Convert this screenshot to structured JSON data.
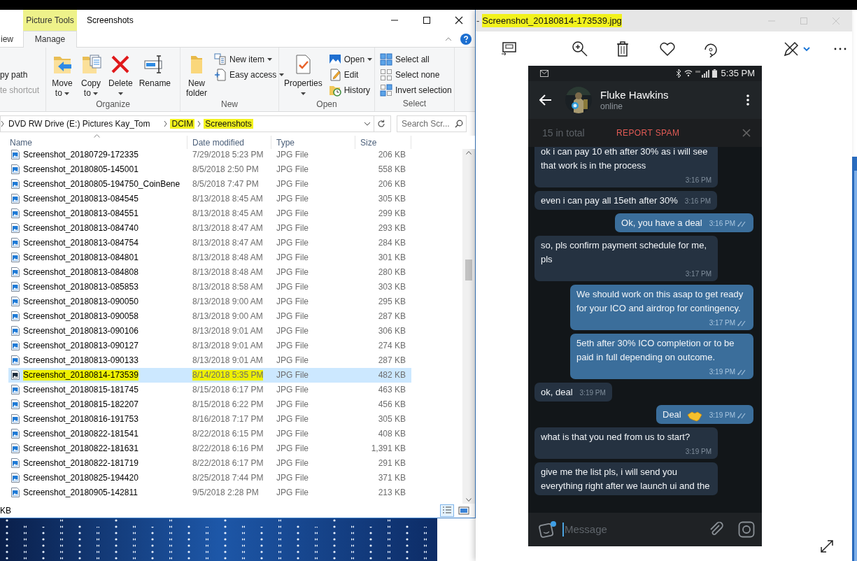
{
  "explorer": {
    "context_tab": {
      "label": "Picture Tools",
      "highlighted": true
    },
    "title": "Screenshots",
    "tabs": [
      {
        "label": "iew",
        "selected": false
      },
      {
        "label": "Manage",
        "selected": true
      }
    ],
    "ribbon": {
      "partial": [
        {
          "label": "py path",
          "disabled": false
        },
        {
          "label": "te shortcut",
          "disabled": true
        }
      ],
      "groups": [
        {
          "label": "Organize",
          "items": [
            {
              "kind": "move",
              "label": "Move to",
              "has_menu": true
            },
            {
              "kind": "copy",
              "label": "Copy to",
              "has_menu": true
            },
            {
              "kind": "delete",
              "label": "Delete",
              "has_menu": true
            },
            {
              "kind": "rename",
              "label": "Rename",
              "has_menu": false
            }
          ]
        },
        {
          "label": "New",
          "items": [
            {
              "kind": "new_folder",
              "label": "New folder",
              "has_menu": false
            },
            {
              "kind": "new_item",
              "label": "New item",
              "has_menu": true
            },
            {
              "kind": "easy_access",
              "label": "Easy access",
              "has_menu": true
            }
          ]
        },
        {
          "label": "Open",
          "items": [
            {
              "kind": "properties",
              "label": "Properties",
              "has_menu": true
            },
            {
              "kind": "open",
              "label": "Open",
              "has_menu": true
            },
            {
              "kind": "edit",
              "label": "Edit",
              "has_menu": false
            },
            {
              "kind": "history",
              "label": "History",
              "has_menu": false
            }
          ]
        },
        {
          "label": "Select",
          "items": [
            {
              "kind": "select_all",
              "label": "Select all",
              "has_menu": false
            },
            {
              "kind": "select_none",
              "label": "Select none",
              "has_menu": false
            },
            {
              "kind": "invert_selection",
              "label": "Invert selection",
              "has_menu": false
            }
          ]
        }
      ]
    },
    "path": [
      {
        "label": "DVD RW Drive (E:) Pictures Kay_Tom",
        "highlighted": false
      },
      {
        "label": "DCIM",
        "highlighted": true
      },
      {
        "label": "Screenshots",
        "highlighted": true
      }
    ],
    "search": {
      "placeholder": "Search Scr..."
    },
    "columns": [
      {
        "label": "Name",
        "sorted": true
      },
      {
        "label": "Date modified",
        "sorted": false
      },
      {
        "label": "Type",
        "sorted": false
      },
      {
        "label": "Size",
        "sorted": false
      }
    ],
    "rows": [
      {
        "name": "Screenshot_20180729-172335",
        "date": "7/29/2018 5:23 PM",
        "type": "JPG File",
        "size": "206 KB",
        "selected": false,
        "highlighted": false
      },
      {
        "name": "Screenshot_20180805-145001",
        "date": "8/5/2018 2:50 PM",
        "type": "JPG File",
        "size": "558 KB",
        "selected": false,
        "highlighted": false
      },
      {
        "name": "Screenshot_20180805-194750_CoinBene",
        "date": "8/5/2018 7:47 PM",
        "type": "JPG File",
        "size": "206 KB",
        "selected": false,
        "highlighted": false
      },
      {
        "name": "Screenshot_20180813-084545",
        "date": "8/13/2018 8:45 AM",
        "type": "JPG File",
        "size": "305 KB",
        "selected": false,
        "highlighted": false
      },
      {
        "name": "Screenshot_20180813-084551",
        "date": "8/13/2018 8:45 AM",
        "type": "JPG File",
        "size": "299 KB",
        "selected": false,
        "highlighted": false
      },
      {
        "name": "Screenshot_20180813-084740",
        "date": "8/13/2018 8:47 AM",
        "type": "JPG File",
        "size": "293 KB",
        "selected": false,
        "highlighted": false
      },
      {
        "name": "Screenshot_20180813-084754",
        "date": "8/13/2018 8:47 AM",
        "type": "JPG File",
        "size": "284 KB",
        "selected": false,
        "highlighted": false
      },
      {
        "name": "Screenshot_20180813-084801",
        "date": "8/13/2018 8:48 AM",
        "type": "JPG File",
        "size": "301 KB",
        "selected": false,
        "highlighted": false
      },
      {
        "name": "Screenshot_20180813-084808",
        "date": "8/13/2018 8:48 AM",
        "type": "JPG File",
        "size": "280 KB",
        "selected": false,
        "highlighted": false
      },
      {
        "name": "Screenshot_20180813-085853",
        "date": "8/13/2018 8:58 AM",
        "type": "JPG File",
        "size": "303 KB",
        "selected": false,
        "highlighted": false
      },
      {
        "name": "Screenshot_20180813-090050",
        "date": "8/13/2018 9:00 AM",
        "type": "JPG File",
        "size": "295 KB",
        "selected": false,
        "highlighted": false
      },
      {
        "name": "Screenshot_20180813-090058",
        "date": "8/13/2018 9:00 AM",
        "type": "JPG File",
        "size": "287 KB",
        "selected": false,
        "highlighted": false
      },
      {
        "name": "Screenshot_20180813-090106",
        "date": "8/13/2018 9:01 AM",
        "type": "JPG File",
        "size": "306 KB",
        "selected": false,
        "highlighted": false
      },
      {
        "name": "Screenshot_20180813-090127",
        "date": "8/13/2018 9:01 AM",
        "type": "JPG File",
        "size": "274 KB",
        "selected": false,
        "highlighted": false
      },
      {
        "name": "Screenshot_20180813-090133",
        "date": "8/13/2018 9:01 AM",
        "type": "JPG File",
        "size": "287 KB",
        "selected": false,
        "highlighted": false
      },
      {
        "name": "Screenshot_20180814-173539",
        "date": "8/14/2018 5:35 PM",
        "type": "JPG File",
        "size": "482 KB",
        "selected": true,
        "highlighted": true
      },
      {
        "name": "Screenshot_20180815-181745",
        "date": "8/15/2018 6:17 PM",
        "type": "JPG File",
        "size": "463 KB",
        "selected": false,
        "highlighted": false
      },
      {
        "name": "Screenshot_20180815-182207",
        "date": "8/15/2018 6:22 PM",
        "type": "JPG File",
        "size": "456 KB",
        "selected": false,
        "highlighted": false
      },
      {
        "name": "Screenshot_20180816-191753",
        "date": "8/16/2018 7:17 PM",
        "type": "JPG File",
        "size": "305 KB",
        "selected": false,
        "highlighted": false
      },
      {
        "name": "Screenshot_20180822-181541",
        "date": "8/22/2018 6:15 PM",
        "type": "JPG File",
        "size": "408 KB",
        "selected": false,
        "highlighted": false
      },
      {
        "name": "Screenshot_20180822-181631",
        "date": "8/22/2018 6:16 PM",
        "type": "JPG File",
        "size": "1,391 KB",
        "selected": false,
        "highlighted": false
      },
      {
        "name": "Screenshot_20180822-181719",
        "date": "8/22/2018 6:17 PM",
        "type": "JPG File",
        "size": "291 KB",
        "selected": false,
        "highlighted": false
      },
      {
        "name": "Screenshot_20180825-194420",
        "date": "8/25/2018 7:44 PM",
        "type": "JPG File",
        "size": "371 KB",
        "selected": false,
        "highlighted": false
      },
      {
        "name": "Screenshot_20180905-142811",
        "date": "9/5/2018 2:28 PM",
        "type": "JPG File",
        "size": "213 KB",
        "selected": false,
        "highlighted": false
      }
    ],
    "status_bar": {
      "text": "KB"
    }
  },
  "photo_viewer": {
    "title_prefix": "-",
    "title": "Screenshot_20180814-173539.jpg",
    "title_highlighted": true,
    "chat": {
      "status_time": "5:35 PM",
      "contact": "Fluke Hawkins",
      "presence": "online",
      "spam_bar": {
        "behind_text": "15 in total",
        "action": "REPORT SPAM"
      },
      "messages": [
        {
          "text": "ok i can pay 10 eth after 30% as i will see that work is in the process",
          "time": "3:16 PM",
          "outgoing": false,
          "read": false
        },
        {
          "text": "even i can pay all 15eth after 30%",
          "time": "3:16 PM",
          "outgoing": false,
          "read": false
        },
        {
          "text": "Ok, you have a deal",
          "time": "3:16 PM",
          "outgoing": true,
          "read": true
        },
        {
          "text": "so, pls confirm payment schedule for me, pls",
          "time": "3:17 PM",
          "outgoing": false,
          "read": false
        },
        {
          "text": "We should work on this asap to get ready for your ICO and airdrop for contingency.",
          "time": "3:17 PM",
          "outgoing": true,
          "read": true
        },
        {
          "text": "5eth after 30% ICO completion or to be paid in full depending on outcome.",
          "time": "3:19 PM",
          "outgoing": true,
          "read": true
        },
        {
          "text": "ok, deal",
          "time": "3:19 PM",
          "outgoing": false,
          "read": false
        },
        {
          "text": "Deal",
          "time": "3:19 PM",
          "outgoing": true,
          "read": true,
          "handshake": true
        },
        {
          "text": "what is that you ned from us to start?",
          "time": "3:19 PM",
          "outgoing": false,
          "read": false
        },
        {
          "text": "give me the list pls, i will send you everything right after we launch ui and the",
          "outgoing": false
        }
      ],
      "composer": {
        "placeholder": "Message"
      }
    }
  }
}
